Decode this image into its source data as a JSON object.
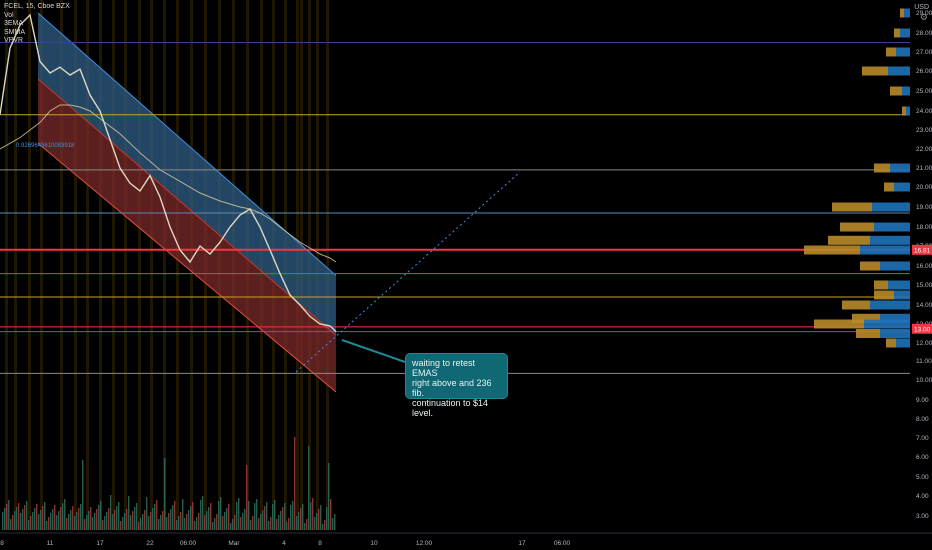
{
  "header": {
    "symbol_line": "FCEL, 15, Cboe BZX",
    "indicators": [
      "Vol",
      "3EMA",
      "SMMA",
      "VPVR"
    ],
    "currency": "USD"
  },
  "colors": {
    "background": "#000000",
    "channel_upper": "#2f5d87",
    "channel_lower": "#7b2a2a",
    "red_line": "#f23645",
    "gold_line": "#c9a227",
    "vp_up": "#1f72b8",
    "vp_down": "#b8892a"
  },
  "fib_label": "0.9269643610083918",
  "annotation": {
    "lines": [
      "waiting to retest EMAS",
      "right above and 236 fib.",
      "continuation to $14",
      "level."
    ]
  },
  "chart_data": {
    "type": "line",
    "title": "FCEL, 15, Cboe BZX",
    "ylabel": "USD",
    "ylim": [
      2.2,
      29.2
    ],
    "y_ticks": [
      3.0,
      4.0,
      5.0,
      6.0,
      7.0,
      8.0,
      9.0,
      10.0,
      11.0,
      12.0,
      13.0,
      14.0,
      15.0,
      16.0,
      17.0,
      18.0,
      19.0,
      20.0,
      21.0,
      22.0,
      23.0,
      24.0,
      25.0,
      26.0,
      27.0,
      28.0,
      29.0
    ],
    "y_tick_labels": [
      "3.00",
      "4.00",
      "5.00",
      "6.00",
      "7.00",
      "8.00",
      "9.00",
      "10.00",
      "11.00",
      "12.00",
      "13.00",
      "14.00",
      "15.00",
      "16.00",
      "17.00",
      "18.00",
      "19.00",
      "20.00",
      "21.00",
      "22.00",
      "23.00",
      "24.00",
      "25.00",
      "26.00",
      "27.00",
      "28.00",
      "29.00"
    ],
    "x_tick_labels": [
      "8",
      "11",
      "17",
      "22",
      "06:00",
      "Mar",
      "4",
      "8",
      "10",
      "12:00",
      "17",
      "06:00"
    ],
    "price_badges": [
      {
        "label": "16.81",
        "price": 16.81,
        "color": "#f23645"
      },
      {
        "label": "13.00",
        "price": 12.75,
        "color": "#f23645"
      }
    ],
    "horizontal_levels": [
      {
        "price": 27.5,
        "color": "#3a3f8f"
      },
      {
        "price": 23.8,
        "color": "#c9a227"
      },
      {
        "price": 20.9,
        "color": "#8a8a8a"
      },
      {
        "price": 18.7,
        "color": "#5b8bb5"
      },
      {
        "price": 16.81,
        "color": "#f23645"
      },
      {
        "price": 15.6,
        "color": "#3f8f5a"
      },
      {
        "price": 14.4,
        "color": "#c9a227"
      },
      {
        "price": 12.85,
        "color": "#f23645"
      },
      {
        "price": 12.6,
        "color": "#9c4d7a"
      },
      {
        "price": 10.35,
        "color": "#8a8a8a"
      }
    ],
    "series": [
      {
        "name": "3EMA",
        "x": [
          0,
          5,
          10,
          20,
          30,
          40,
          50,
          60,
          70,
          80,
          90,
          100,
          110,
          120,
          130,
          140,
          150,
          160,
          170,
          180,
          190,
          200,
          210,
          220,
          230,
          240,
          250,
          260,
          270,
          280,
          290,
          300,
          310,
          320,
          330,
          336
        ],
        "values": [
          23.8,
          25.5,
          27.2,
          28.4,
          28.9,
          26.5,
          25.9,
          26.2,
          25.8,
          26.1,
          24.8,
          24.0,
          22.5,
          21.0,
          20.2,
          19.8,
          20.6,
          19.5,
          18.0,
          16.8,
          16.2,
          17.0,
          16.6,
          17.2,
          18.0,
          18.6,
          18.9,
          18.0,
          16.8,
          15.6,
          14.5,
          14.0,
          13.4,
          13.0,
          12.9,
          12.6
        ]
      },
      {
        "name": "SMMA",
        "x": [
          0,
          10,
          20,
          30,
          40,
          50,
          60,
          70,
          80,
          90,
          100,
          120,
          140,
          160,
          180,
          200,
          220,
          240,
          250,
          260,
          270,
          280,
          290,
          300,
          310,
          320,
          330,
          336
        ],
        "values": [
          22.0,
          22.3,
          22.6,
          23.0,
          23.4,
          24.0,
          24.3,
          24.3,
          24.2,
          24.0,
          23.6,
          22.8,
          21.8,
          20.9,
          20.3,
          19.7,
          19.3,
          19.0,
          18.9,
          18.7,
          18.4,
          18.0,
          17.6,
          17.2,
          16.9,
          16.6,
          16.4,
          16.2
        ]
      }
    ],
    "regression_channel": {
      "upper": {
        "x": [
          38,
          336
        ],
        "values": [
          29.0,
          15.5
        ]
      },
      "mid": {
        "x": [
          38,
          336
        ],
        "values": [
          25.6,
          12.4
        ]
      },
      "lower": {
        "x": [
          38,
          336
        ],
        "values": [
          22.3,
          9.4
        ]
      }
    },
    "volume_profile": [
      {
        "price": 29.0,
        "up": 6,
        "down": 4
      },
      {
        "price": 28.0,
        "up": 10,
        "down": 6
      },
      {
        "price": 27.0,
        "up": 14,
        "down": 10
      },
      {
        "price": 26.0,
        "up": 22,
        "down": 26
      },
      {
        "price": 25.0,
        "up": 8,
        "down": 12
      },
      {
        "price": 24.0,
        "up": 4,
        "down": 4
      },
      {
        "price": 21.0,
        "up": 20,
        "down": 16
      },
      {
        "price": 20.0,
        "up": 16,
        "down": 10
      },
      {
        "price": 19.0,
        "up": 38,
        "down": 40
      },
      {
        "price": 18.0,
        "up": 36,
        "down": 34
      },
      {
        "price": 17.3,
        "up": 40,
        "down": 42
      },
      {
        "price": 16.8,
        "up": 50,
        "down": 56
      },
      {
        "price": 16.0,
        "up": 30,
        "down": 20
      },
      {
        "price": 15.0,
        "up": 22,
        "down": 14
      },
      {
        "price": 14.5,
        "up": 16,
        "down": 20
      },
      {
        "price": 14.0,
        "up": 40,
        "down": 28
      },
      {
        "price": 13.3,
        "up": 30,
        "down": 28
      },
      {
        "price": 13.0,
        "up": 46,
        "down": 50
      },
      {
        "price": 12.5,
        "up": 30,
        "down": 24
      },
      {
        "price": 12.0,
        "up": 14,
        "down": 10
      }
    ]
  }
}
